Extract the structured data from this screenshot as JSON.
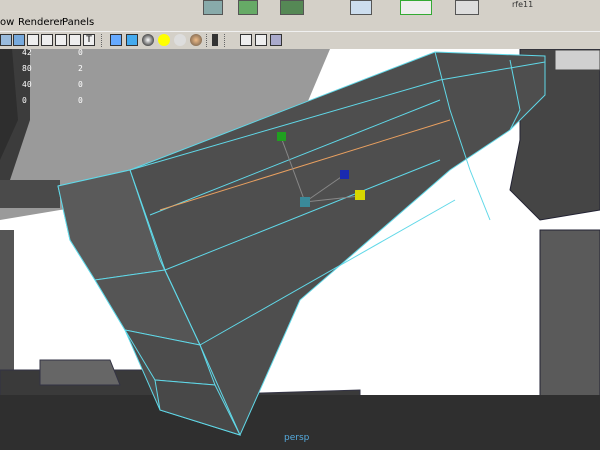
{
  "menu": {
    "item1": "ow",
    "item2": "Renderer",
    "item3": "Panels"
  },
  "hud": {
    "rows": [
      {
        "a": "42",
        "b": "0"
      },
      {
        "a": "80",
        "b": "2"
      },
      {
        "a": "40",
        "b": "0"
      },
      {
        "a": "0",
        "b": "0"
      }
    ]
  },
  "corner_label": "rfe11",
  "camera_label": "persp",
  "colors": {
    "wireframe": "#60d8e8",
    "bg_white": "#ffffff",
    "mesh": "#505050"
  },
  "icons": [
    "select-camera-icon",
    "camera-attributes-icon",
    "bookmark-icon",
    "image-plane-icon",
    "grid-icon",
    "film-gate-icon",
    "resolution-gate-icon",
    "wireframe-icon",
    "smooth-shade-icon",
    "texture-icon",
    "lights-icon",
    "shadows-icon",
    "isolate-icon",
    "xray-icon",
    "backface-icon"
  ]
}
